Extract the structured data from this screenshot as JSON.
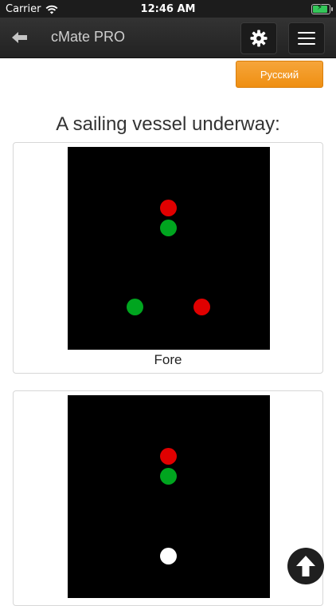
{
  "status_bar": {
    "carrier": "Carrier",
    "time": "12:46 AM"
  },
  "nav": {
    "title": "cMate PRO"
  },
  "language_button": {
    "label": "Русский"
  },
  "page_title": "A sailing vessel underway:",
  "cards": [
    {
      "caption": "Fore"
    }
  ],
  "colors": {
    "red_light": "#e00000",
    "green_light": "#00a51f",
    "white_light": "#ffffff",
    "accent_orange": "#f39a22"
  },
  "icons": {
    "back": "arrow-left-icon",
    "settings": "gear-icon",
    "menu": "hamburger-icon",
    "scroll_top": "arrow-up-icon"
  }
}
